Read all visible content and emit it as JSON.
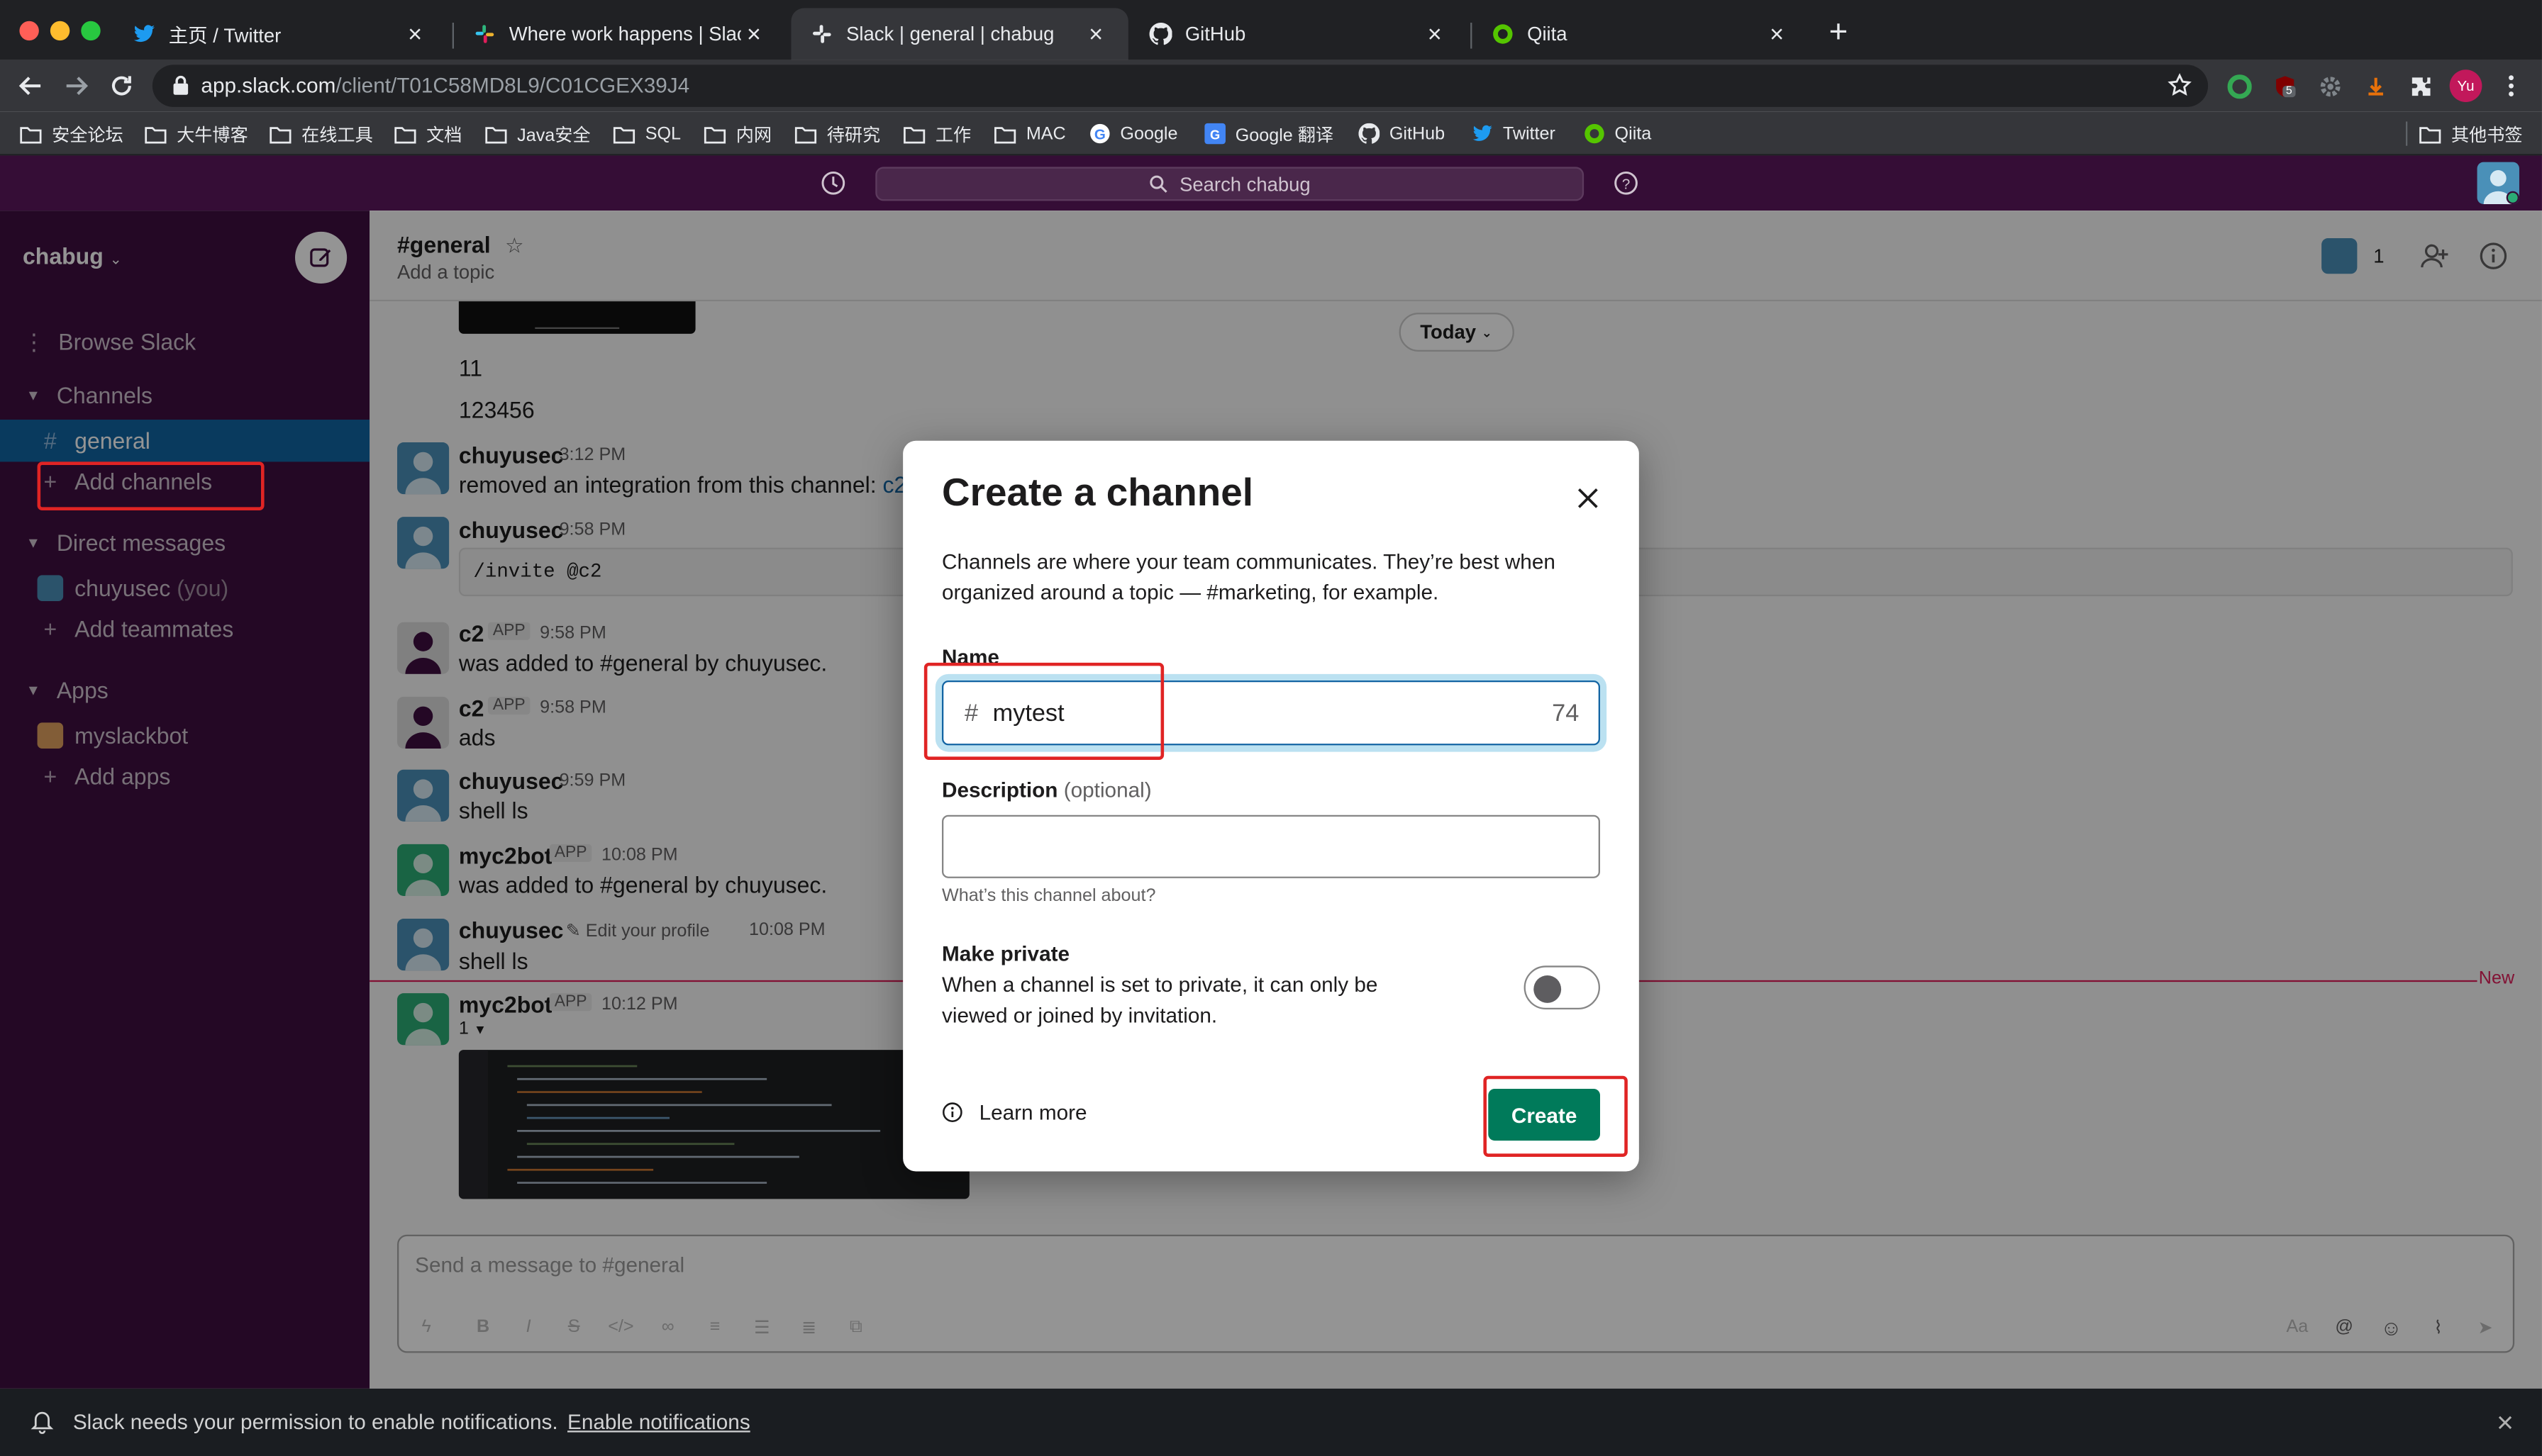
{
  "browser": {
    "tabs": [
      {
        "title": "主页 / Twitter"
      },
      {
        "title": "Where work happens | Slack"
      },
      {
        "title": "Slack | general | chabug"
      },
      {
        "title": "GitHub"
      },
      {
        "title": "Qiita"
      }
    ],
    "url_host": "app.slack.com",
    "url_path": "/client/T01C58MD8L9/C01CGEX39J4",
    "profile_initials": "Yu",
    "ext_badge": "5",
    "bookmarks": [
      "安全论坛",
      "大牛博客",
      "在线工具",
      "文档",
      "Java安全",
      "SQL",
      "内网",
      "待研究",
      "工作",
      "MAC",
      "Google",
      "Google 翻译",
      "GitHub",
      "Twitter",
      "Qiita"
    ],
    "other_bookmarks": "其他书签"
  },
  "slack": {
    "search_placeholder": "Search chabug",
    "workspace": "chabug",
    "sidebar": {
      "browse": "Browse Slack",
      "channels_header": "Channels",
      "channels": [
        "general"
      ],
      "add_channels": "Add channels",
      "dm_header": "Direct messages",
      "dm_user": "chuyusec",
      "dm_you": "(you)",
      "add_teammates": "Add teammates",
      "apps_header": "Apps",
      "apps": [
        "myslackbot"
      ],
      "add_apps": "Add apps"
    },
    "channel": {
      "name": "#general",
      "topic": "Add a topic",
      "member_count": "1"
    },
    "messages": {
      "today": "Today",
      "m0": [
        "11",
        "123456"
      ],
      "m1": {
        "name": "chuyusec",
        "time": "3:12 PM",
        "text": "removed an integration from this channel:",
        "link": "c2"
      },
      "m2": {
        "name": "chuyusec",
        "time": "9:58 PM",
        "code": "/invite @c2"
      },
      "m3": {
        "name": "c2",
        "badge": "APP",
        "time": "9:58 PM",
        "text": "was added to #general by chuyusec."
      },
      "m4": {
        "name": "c2",
        "badge": "APP",
        "time": "9:58 PM",
        "text": "ads"
      },
      "m5": {
        "name": "chuyusec",
        "time": "9:59 PM",
        "text": "shell ls"
      },
      "m6": {
        "name": "myc2bot",
        "badge": "APP",
        "time": "10:08 PM",
        "text": "was added to #general by chuyusec."
      },
      "m7": {
        "name": "chuyusec",
        "edit": "Edit your profile",
        "time": "10:08 PM",
        "text": "shell ls"
      },
      "m8": {
        "name": "myc2bot",
        "badge": "APP",
        "time": "10:12 PM",
        "text": "1"
      },
      "new_label": "New"
    },
    "composer_placeholder": "Send a message to #general",
    "notification": {
      "text": "Slack needs your permission to enable notifications.",
      "link": "Enable notifications"
    }
  },
  "modal": {
    "title": "Create a channel",
    "description": "Channels are where your team communicates. They’re best when organized around a topic — #marketing, for example.",
    "name_label": "Name",
    "name_prefix": "#",
    "name_value": "mytest",
    "name_remaining": "74",
    "desc_label": "Description",
    "desc_optional": "(optional)",
    "desc_hint": "What’s this channel about?",
    "private_title": "Make private",
    "private_desc": "When a channel is set to private, it can only be viewed or joined by invitation.",
    "private_enabled": false,
    "learn_more": "Learn more",
    "create_label": "Create"
  },
  "colors": {
    "sidebar": "#3f0e40",
    "topbar": "#350d36",
    "active_item": "#1164a3",
    "create_button": "#007a5a",
    "annotation": "#e02424"
  }
}
